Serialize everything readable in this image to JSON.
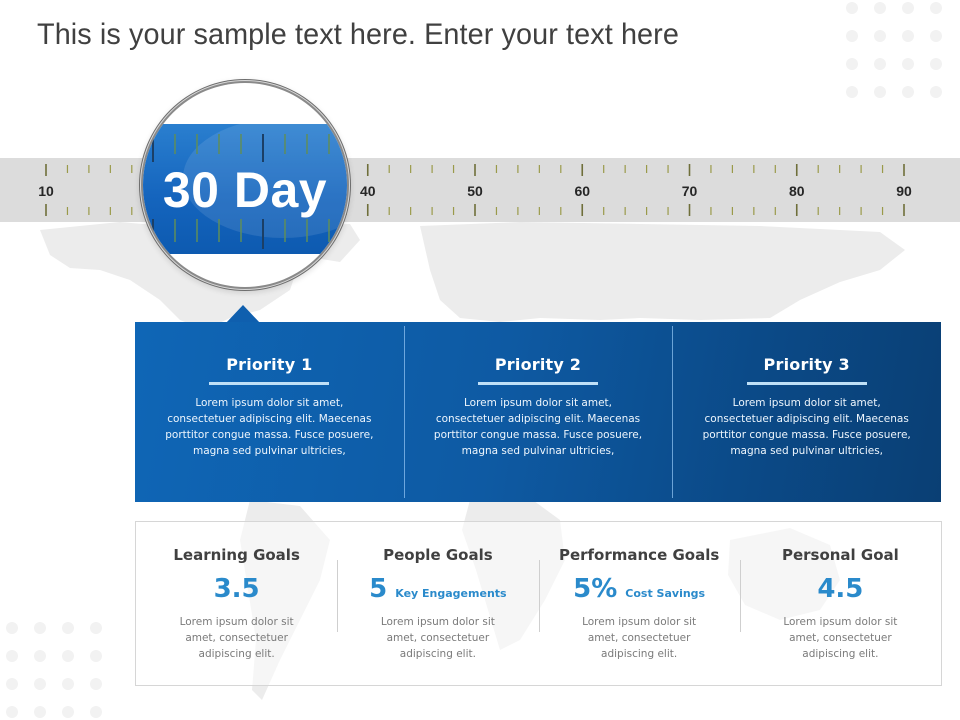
{
  "slide": {
    "title": "This is your sample text here. Enter your text here"
  },
  "ruler": {
    "min": 10,
    "max": 90,
    "major_step": 10,
    "minor_step": 2,
    "labels": [
      "10",
      "40",
      "50",
      "60",
      "70",
      "80",
      "90"
    ],
    "highlighted_value": 30
  },
  "magnifier": {
    "label": "30 Day",
    "colors": {
      "lens": "#1565be"
    }
  },
  "priorities": [
    {
      "title": "Priority  1",
      "body": "Lorem  ipsum dolor sit amet, consectetuer  adipiscing elit. Maecenas porttitor congue  massa. Fusce posuere, magna sed pulvinar ultricies,"
    },
    {
      "title": "Priority  2",
      "body": "Lorem  ipsum dolor sit amet, consectetuer  adipiscing elit. Maecenas porttitor congue  massa. Fusce posuere, magna sed pulvinar ultricies,"
    },
    {
      "title": "Priority  3",
      "body": "Lorem  ipsum dolor sit amet, consectetuer  adipiscing elit. Maecenas porttitor congue  massa. Fusce posuere, magna sed pulvinar ultricies,"
    }
  ],
  "goals": [
    {
      "title": "Learning Goals",
      "value": "3.5",
      "unit": "",
      "body": "Lorem  ipsum dolor sit amet, consectetuer adipiscing elit."
    },
    {
      "title": "People Goals",
      "value": "5",
      "unit": "Key Engagements",
      "body": "Lorem  ipsum dolor sit amet, consectetuer adipiscing elit."
    },
    {
      "title": "Performance Goals",
      "value": "5%",
      "unit": "Cost Savings",
      "body": "Lorem  ipsum dolor sit amet, consectetuer adipiscing elit."
    },
    {
      "title": "Personal Goal",
      "value": "4.5",
      "unit": "",
      "body": "Lorem  ipsum dolor sit amet, consectetuer adipiscing elit."
    }
  ],
  "colors": {
    "accent": "#2a8acb",
    "panel_dark": "#0a3f74",
    "panel_light": "#0f66b6",
    "ruler_bg": "#dcdcdc",
    "tick": "#9a9a4a"
  }
}
